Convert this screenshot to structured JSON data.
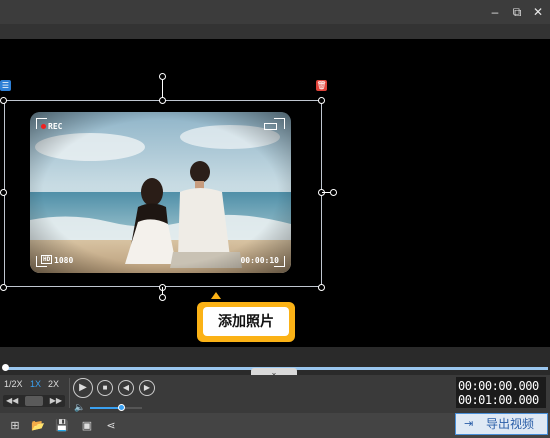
{
  "window": {
    "minimize_icon": "minimize-icon",
    "restore_icon": "restore-icon",
    "close_icon": "close-icon"
  },
  "canvas": {
    "camera_overlay": {
      "rec_label": "REC",
      "quality_label": "1080",
      "hd_label": "HD",
      "timecode": "00:00:10"
    },
    "tooltip_label": "添加照片"
  },
  "playback": {
    "speeds": [
      "1/2X",
      "1X",
      "2X"
    ],
    "active_speed": "1X",
    "current_time": "00:00:00.000",
    "total_time": "00:01:00.000",
    "volume": 0.6
  },
  "toolbar": {
    "export_label": "导出视频"
  },
  "colors": {
    "accent": "#fbb216",
    "active_speed": "#3aa0f0",
    "delete_badge": "#e0433a",
    "menu_badge": "#2d7fd6"
  }
}
